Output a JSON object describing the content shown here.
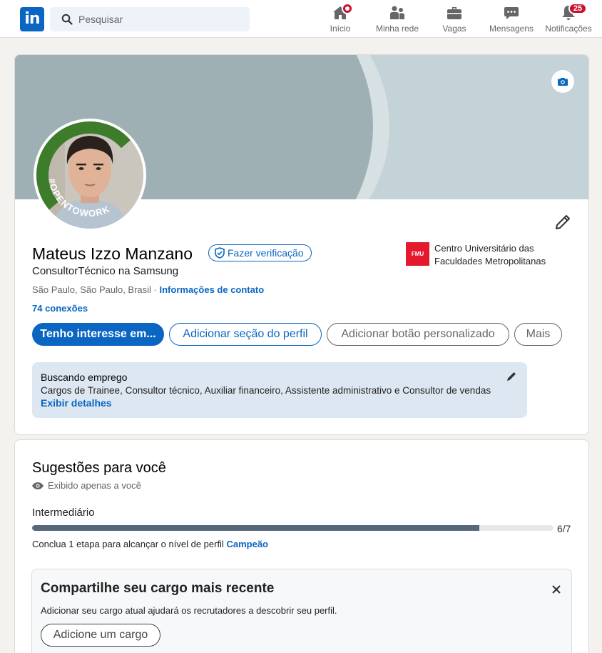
{
  "topnav": {
    "logo": "in",
    "search": {
      "placeholder": "Pesquisar"
    },
    "items": [
      {
        "label": "Início",
        "icon": "home-icon"
      },
      {
        "label": "Minha rede",
        "icon": "network-icon"
      },
      {
        "label": "Vagas",
        "icon": "briefcase-icon"
      },
      {
        "label": "Mensagens",
        "icon": "messaging-icon"
      },
      {
        "label": "Notificações",
        "icon": "bell-icon",
        "badge": "25"
      }
    ]
  },
  "profile": {
    "name": "Mateus Izzo Manzano",
    "verify_label": "Fazer verificação",
    "headline": "ConsultorTécnico na Samsung",
    "location": "São Paulo, São Paulo, Brasil",
    "location_separator": " · ",
    "contact_info": "Informações de contato",
    "connections": "74 conexões",
    "education": {
      "logo_text": "FMU",
      "name": "Centro Universitário das Faculdades Metropolitanas"
    },
    "open_to_work_frame": "#OPENTOWORK",
    "buttons": {
      "open_to": "Tenho interesse em...",
      "add_section": "Adicionar seção do perfil",
      "custom_button": "Adicionar botão personalizado",
      "more": "Mais"
    },
    "job_seeking": {
      "title": "Buscando emprego",
      "roles": "Cargos de Trainee, Consultor técnico, Auxiliar financeiro, Assistente administrativo e Consultor de vendas",
      "details_link": "Exibir detalhes"
    }
  },
  "suggestions": {
    "title": "Sugestões para você",
    "private_note": "Exibido apenas a você",
    "level": "Intermediário",
    "progress": {
      "current": 6,
      "total": 7,
      "text": "6/7"
    },
    "hint_prefix": "Conclua 1 etapa para alcançar o nível de perfil",
    "hint_target": "Campeão",
    "card": {
      "title": "Compartilhe seu cargo mais recente",
      "description": "Adicionar seu cargo atual ajudará os recrutadores a descobrir seu perfil.",
      "button": "Adicione um cargo"
    }
  },
  "colors": {
    "brand": "#0a66c2",
    "open_to_work_green": "#3d7c2a",
    "notification_badge": "#cb112d"
  }
}
